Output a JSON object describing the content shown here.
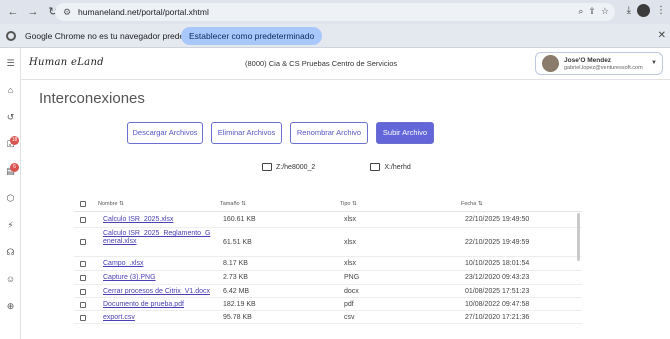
{
  "browser": {
    "url": "humaneland.net/portal/portal.xhtml",
    "infobar_message": "Google Chrome no es tu navegador predeterminado",
    "infobar_button": "Establecer como predeterminado"
  },
  "sidebar": {
    "items": [
      {
        "icon": "home-icon"
      },
      {
        "icon": "history-icon"
      },
      {
        "icon": "tasks-icon",
        "badge": "18"
      },
      {
        "icon": "documents-icon",
        "badge": "6"
      },
      {
        "icon": "cube-icon"
      },
      {
        "icon": "pulse-icon"
      },
      {
        "icon": "headset-icon"
      },
      {
        "icon": "team-icon"
      },
      {
        "icon": "globe-icon"
      }
    ]
  },
  "header": {
    "logo_text": "Human eLand",
    "company": "(8000) Cia & CS Pruebas Centro de Servicios",
    "user": {
      "name": "Jose'O Mendez",
      "email": "gabriel.lopez@venturessoft.com"
    }
  },
  "main": {
    "title": "Interconexiones",
    "buttons": {
      "download": "Descargar Archivos",
      "delete": "Eliminar Archivos",
      "rename": "Renombrar Archivo",
      "upload": "Subir Archivo"
    },
    "folders": [
      "Z:/he8000_2",
      "X:/herhd"
    ],
    "table": {
      "columns": [
        "Nombre",
        "Tamaño",
        "Tipo",
        "Fecha"
      ],
      "rows": [
        {
          "name": "Calculo ISR_2025.xlsx",
          "size": "160.61 KB",
          "type": "xlsx",
          "date": "22/10/2025 19:49:50"
        },
        {
          "name": "Calculo ISR_2025_Reglamento_General.xlsx",
          "size": "61.51 KB",
          "type": "xlsx",
          "date": "22/10/2025 19:49:59"
        },
        {
          "name": "Campo_.xlsx",
          "size": "8.17 KB",
          "type": "xlsx",
          "date": "10/10/2025 18:01:54"
        },
        {
          "name": "Capture (3).PNG",
          "size": "2.73 KB",
          "type": "PNG",
          "date": "23/12/2020 09:43:23"
        },
        {
          "name": "Cerrar procesos de Citrix_V1.docx",
          "size": "6.42 MB",
          "type": "docx",
          "date": "01/08/2025 17:51:23"
        },
        {
          "name": "Documento de prueba.pdf",
          "size": "182.19 KB",
          "type": "pdf",
          "date": "10/08/2022 09:47:58"
        },
        {
          "name": "export.csv",
          "size": "95.78 KB",
          "type": "csv",
          "date": "27/10/2020 17:21:36"
        }
      ]
    }
  }
}
